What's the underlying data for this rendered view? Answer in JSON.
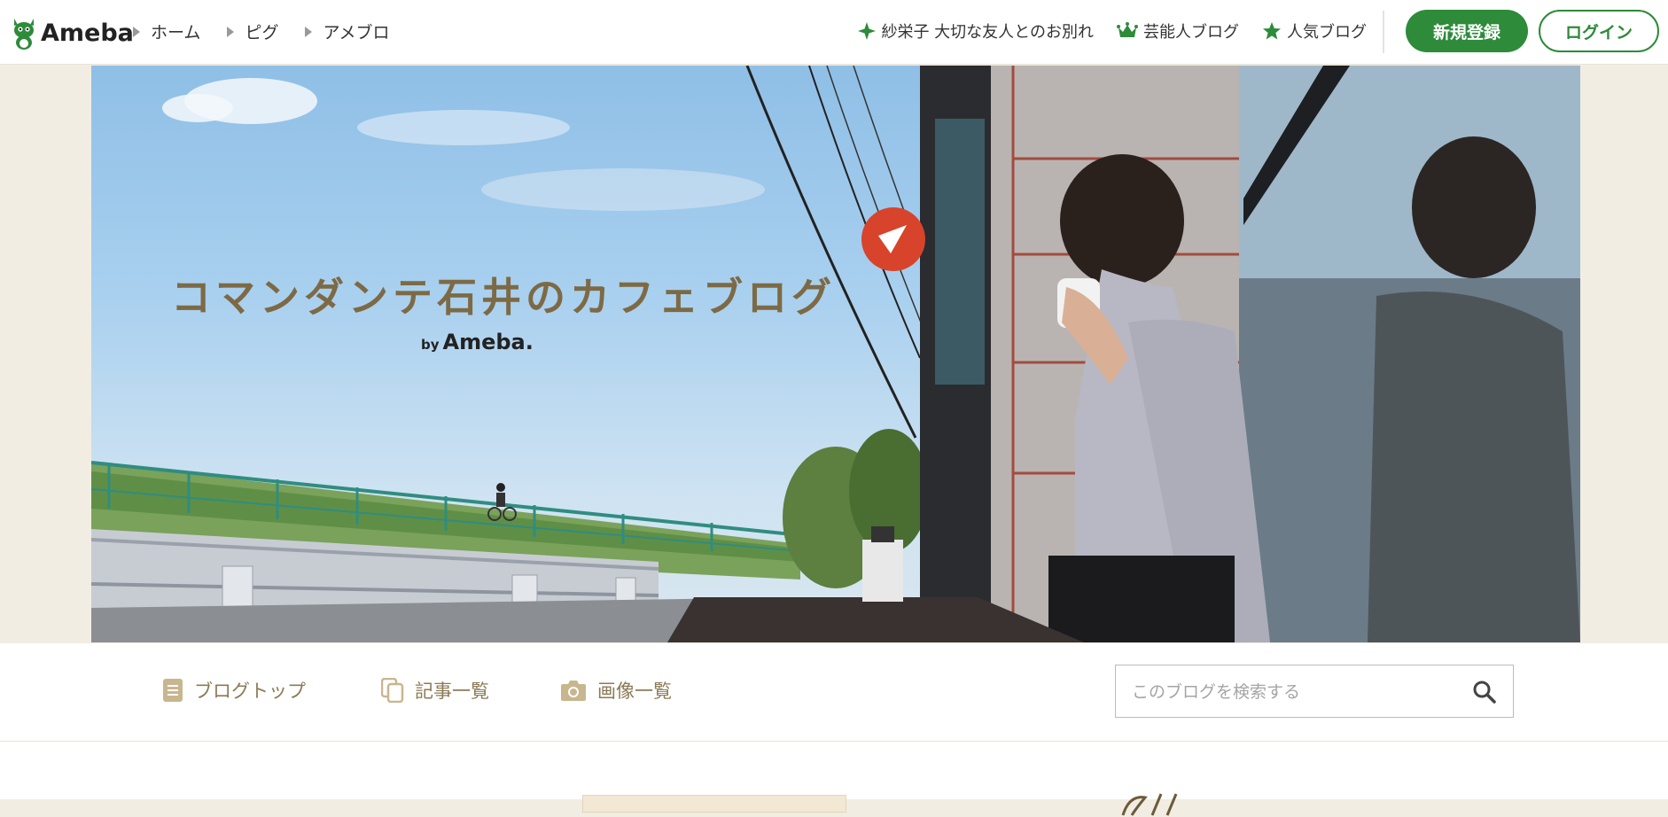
{
  "header": {
    "logo_text": "Ameba",
    "breadcrumbs": [
      "ホーム",
      "ピグ",
      "アメブロ"
    ],
    "links": [
      {
        "icon": "sparkle-icon",
        "label": "紗栄子 大切な友人とのお別れ"
      },
      {
        "icon": "crown-icon",
        "label": "芸能人ブログ"
      },
      {
        "icon": "star-icon",
        "label": "人気ブログ"
      }
    ],
    "register_label": "新規登録",
    "login_label": "ログイン",
    "brand_color": "#2d8b3a"
  },
  "hero": {
    "title": "コマンダンテ石井のカフェブログ",
    "by": "by",
    "brand": "Ameba."
  },
  "subnav": {
    "items": [
      {
        "icon": "document-icon",
        "label": "ブログトップ"
      },
      {
        "icon": "copy-icon",
        "label": "記事一覧"
      },
      {
        "icon": "camera-icon",
        "label": "画像一覧"
      }
    ],
    "search_placeholder": "このブログを検索する"
  }
}
